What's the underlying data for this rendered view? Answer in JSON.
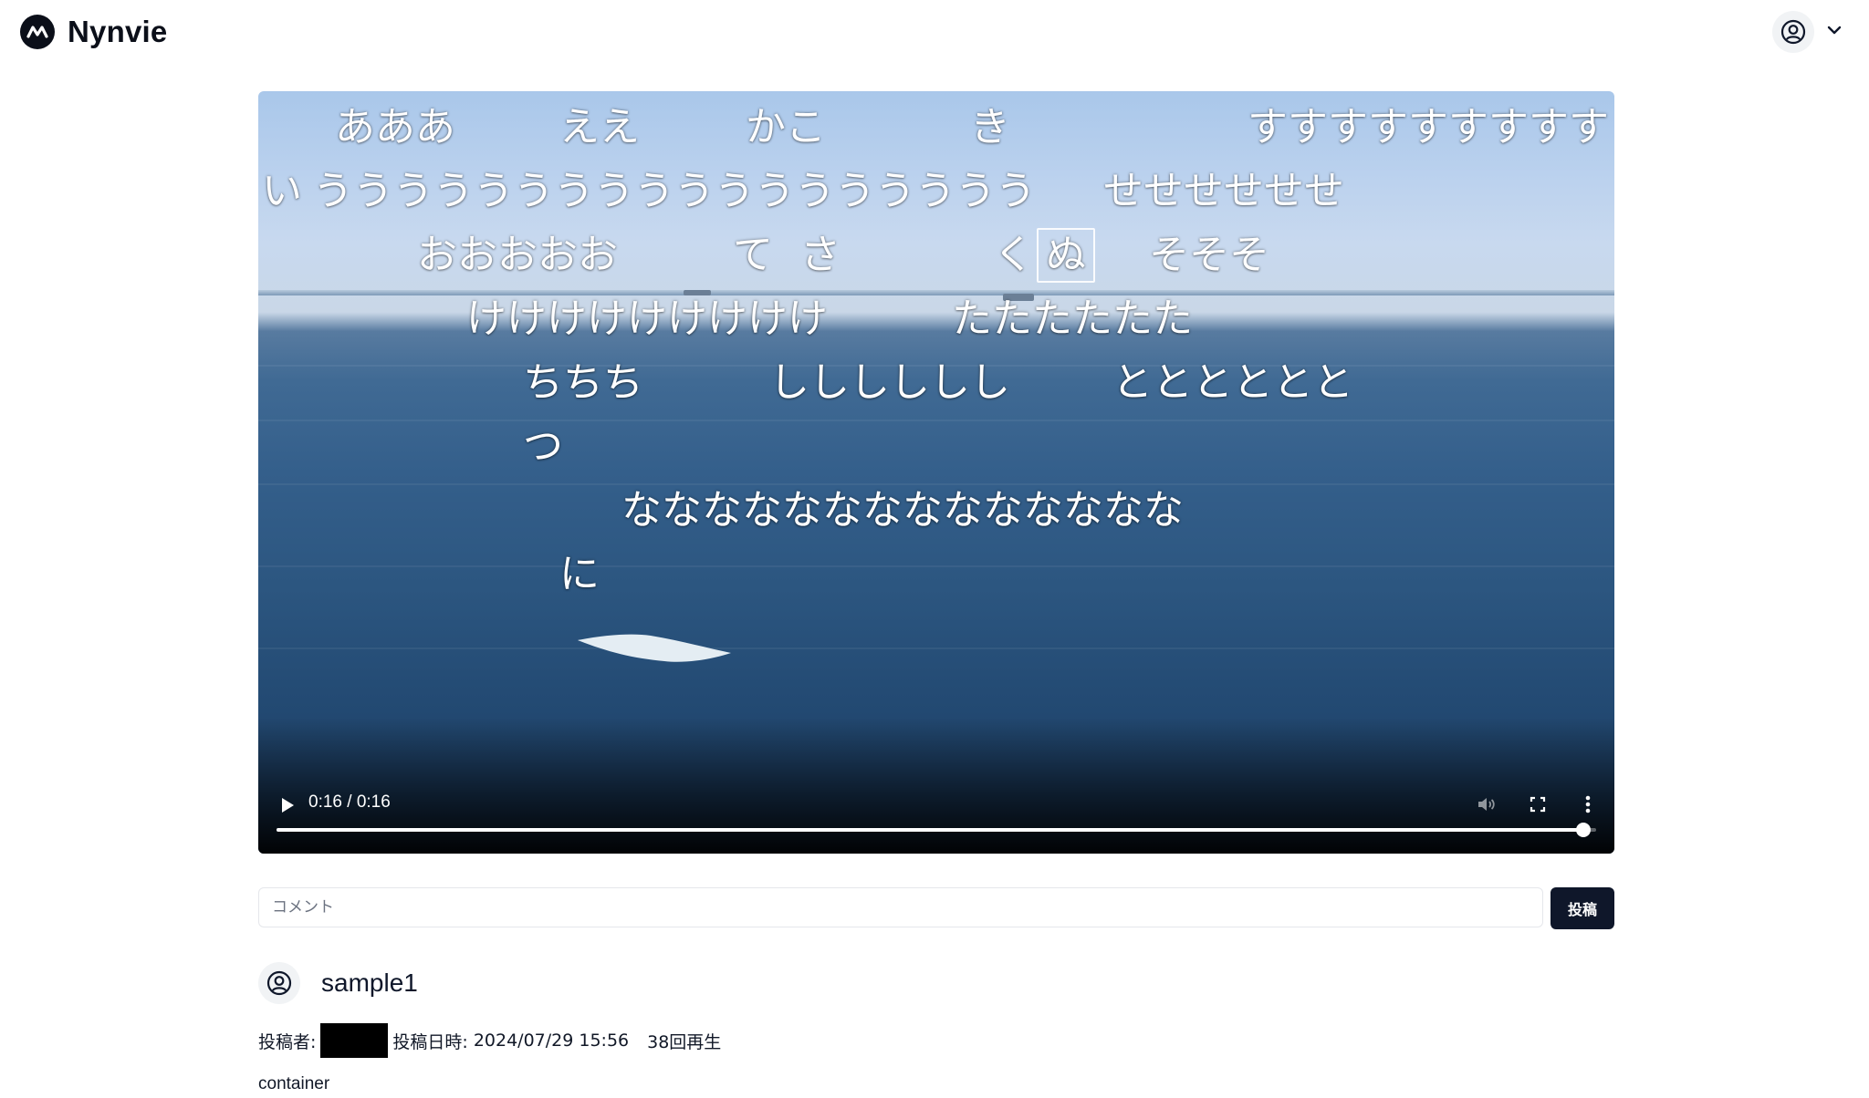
{
  "app": {
    "name": "Nynvie"
  },
  "icons": {
    "logo": "nynvie-logo-icon",
    "user": "user-circle-icon",
    "menu": "chevron-down-icon",
    "play": "play-icon",
    "volume": "volume-icon",
    "fullscreen": "fullscreen-icon",
    "more": "more-vertical-icon"
  },
  "colors": {
    "brand_dark": "#0f172a",
    "post_button_bg": "#0f172a",
    "redaction": "#000000"
  },
  "player": {
    "time": "0:16 / 0:16",
    "progress_fraction": 0.99
  },
  "danmaku": [
    {
      "text": "あああ"
    },
    {
      "text": "ええ"
    },
    {
      "text": "かこ"
    },
    {
      "text": "き"
    },
    {
      "text": "すすすすすすすすす"
    },
    {
      "text": "い"
    },
    {
      "text": "うううううううううううううううううう"
    },
    {
      "text": "せせせせせせ"
    },
    {
      "text": "おおおおお"
    },
    {
      "text": "て"
    },
    {
      "text": "さ"
    },
    {
      "text": "く"
    },
    {
      "text": "ぬ"
    },
    {
      "text": "そそそ"
    },
    {
      "text": "けけけけけけけけけ"
    },
    {
      "text": "たたたたたた"
    },
    {
      "text": "ちちち"
    },
    {
      "text": "しししししし"
    },
    {
      "text": "とととととと"
    },
    {
      "text": "つ"
    },
    {
      "text": "なななななななななななななな"
    },
    {
      "text": "に"
    }
  ],
  "comment": {
    "placeholder": "コメント",
    "value": "",
    "post_label": "投稿"
  },
  "video_info": {
    "title": "sample1",
    "poster_label": "投稿者:",
    "posted_at_label": "投稿日時:",
    "posted_at": "2024/07/29 15:56",
    "views": "38回再生",
    "description": "container"
  }
}
